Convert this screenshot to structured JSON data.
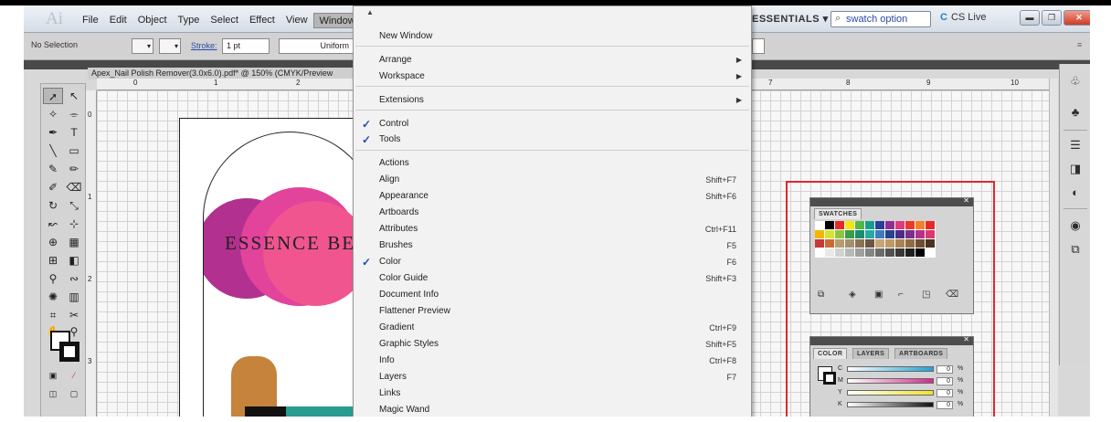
{
  "app": {
    "logo": "Ai",
    "menu": [
      "File",
      "Edit",
      "Object",
      "Type",
      "Select",
      "Effect",
      "View",
      "Window"
    ],
    "active_menu": "Window",
    "workspace": "ESSENTIALS ▾",
    "search_value": "swatch option",
    "cs_live": "CS Live"
  },
  "control_bar": {
    "selection": "No Selection",
    "stroke_label": "Stroke:",
    "stroke_weight": "1 pt",
    "stroke_profile": "Uniform"
  },
  "document": {
    "tab_title": "Apex_Nail Polish Remover(3.0x6.0).pdf* @ 150% (CMYK/Preview",
    "ruler_numbers": [
      "0",
      "1",
      "2",
      "7",
      "8",
      "9",
      "10"
    ],
    "vruler_numbers": [
      "0",
      "1",
      "2",
      "3"
    ],
    "art_text": "ESSENCE BEA"
  },
  "window_menu": {
    "items": [
      {
        "label": "New Window",
        "shortcut": "",
        "submenu": false,
        "checked": false
      },
      {
        "label": "Arrange",
        "shortcut": "",
        "submenu": true,
        "checked": false
      },
      {
        "label": "Workspace",
        "shortcut": "",
        "submenu": true,
        "checked": false
      },
      {
        "label": "Extensions",
        "shortcut": "",
        "submenu": true,
        "checked": false
      },
      {
        "label": "Control",
        "shortcut": "",
        "submenu": false,
        "checked": true
      },
      {
        "label": "Tools",
        "shortcut": "",
        "submenu": false,
        "checked": true
      },
      {
        "label": "Actions",
        "shortcut": "",
        "submenu": false,
        "checked": false
      },
      {
        "label": "Align",
        "shortcut": "Shift+F7",
        "submenu": false,
        "checked": false
      },
      {
        "label": "Appearance",
        "shortcut": "Shift+F6",
        "submenu": false,
        "checked": false
      },
      {
        "label": "Artboards",
        "shortcut": "",
        "submenu": false,
        "checked": false
      },
      {
        "label": "Attributes",
        "shortcut": "Ctrl+F11",
        "submenu": false,
        "checked": false
      },
      {
        "label": "Brushes",
        "shortcut": "F5",
        "submenu": false,
        "checked": false
      },
      {
        "label": "Color",
        "shortcut": "F6",
        "submenu": false,
        "checked": true
      },
      {
        "label": "Color Guide",
        "shortcut": "Shift+F3",
        "submenu": false,
        "checked": false
      },
      {
        "label": "Document Info",
        "shortcut": "",
        "submenu": false,
        "checked": false
      },
      {
        "label": "Flattener Preview",
        "shortcut": "",
        "submenu": false,
        "checked": false
      },
      {
        "label": "Gradient",
        "shortcut": "Ctrl+F9",
        "submenu": false,
        "checked": false
      },
      {
        "label": "Graphic Styles",
        "shortcut": "Shift+F5",
        "submenu": false,
        "checked": false
      },
      {
        "label": "Info",
        "shortcut": "Ctrl+F8",
        "submenu": false,
        "checked": false
      },
      {
        "label": "Layers",
        "shortcut": "F7",
        "submenu": false,
        "checked": false
      },
      {
        "label": "Links",
        "shortcut": "",
        "submenu": false,
        "checked": false
      },
      {
        "label": "Magic Wand",
        "shortcut": "",
        "submenu": false,
        "checked": false
      }
    ]
  },
  "swatches_panel": {
    "tab": "SWATCHES",
    "rows": [
      [
        "#ffffff",
        "#000000",
        "#e32a2a",
        "#f5e60f",
        "#52b845",
        "#1a9b8f",
        "#2b3f99",
        "#8f2f93",
        "#e03a7f",
        "#e8392a",
        "#f0802a",
        "#e9262a"
      ],
      [
        "#f2b800",
        "#d8e236",
        "#8cc63f",
        "#3a9e47",
        "#1b8f6b",
        "#2aa8a3",
        "#3e7bbf",
        "#27428f",
        "#4b2d87",
        "#7a2f88",
        "#b43189",
        "#d73a6b"
      ],
      [
        "#c73838",
        "#cc6a31",
        "#b69d70",
        "#a38f6c",
        "#8b7255",
        "#6b5643",
        "#c8a47a",
        "#bf9966",
        "#a98354",
        "#8f6b44",
        "#6e4f33",
        "#4a3322"
      ],
      [
        "#ffffff",
        "#e9e9e9",
        "#d1d1d1",
        "#b8b8b8",
        "#9f9f9f",
        "#858585",
        "#6b6b6b",
        "#525252",
        "#383838",
        "#1f1f1f",
        "#000000",
        "#ffffff"
      ]
    ]
  },
  "color_panel": {
    "tabs": [
      "COLOR",
      "LAYERS",
      "ARTBOARDS"
    ],
    "channels": [
      {
        "name": "C",
        "value": "0",
        "color": "#21a3d6"
      },
      {
        "name": "M",
        "value": "0",
        "color": "#d42a8c"
      },
      {
        "name": "Y",
        "value": "0",
        "color": "#f2e22b"
      },
      {
        "name": "K",
        "value": "0",
        "color": "#111111"
      }
    ],
    "unit": "%"
  }
}
